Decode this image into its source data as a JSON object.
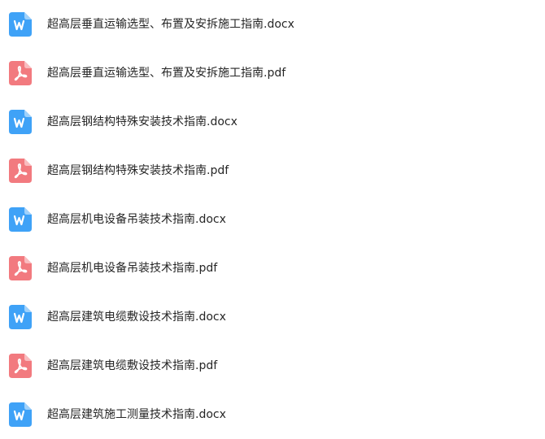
{
  "files": [
    {
      "name": "超高层垂直运输选型、布置及安拆施工指南.docx",
      "type": "word",
      "icon": "word-doc-icon"
    },
    {
      "name": "超高层垂直运输选型、布置及安拆施工指南.pdf",
      "type": "pdf",
      "icon": "pdf-doc-icon"
    },
    {
      "name": "超高层钢结构特殊安装技术指南.docx",
      "type": "word",
      "icon": "word-doc-icon"
    },
    {
      "name": "超高层钢结构特殊安装技术指南.pdf",
      "type": "pdf",
      "icon": "pdf-doc-icon"
    },
    {
      "name": "超高层机电设备吊装技术指南.docx",
      "type": "word",
      "icon": "word-doc-icon"
    },
    {
      "name": "超高层机电设备吊装技术指南.pdf",
      "type": "pdf",
      "icon": "pdf-doc-icon"
    },
    {
      "name": "超高层建筑电缆敷设技术指南.docx",
      "type": "word",
      "icon": "word-doc-icon"
    },
    {
      "name": "超高层建筑电缆敷设技术指南.pdf",
      "type": "pdf",
      "icon": "pdf-doc-icon"
    },
    {
      "name": "超高层建筑施工测量技术指南.docx",
      "type": "word",
      "icon": "word-doc-icon"
    }
  ],
  "colors": {
    "word_icon": "#3fa2f7",
    "word_icon_fold": "#9fd1fb",
    "pdf_icon": "#f27a7f",
    "pdf_icon_fold": "#f9bcbf",
    "text": "#262626"
  }
}
